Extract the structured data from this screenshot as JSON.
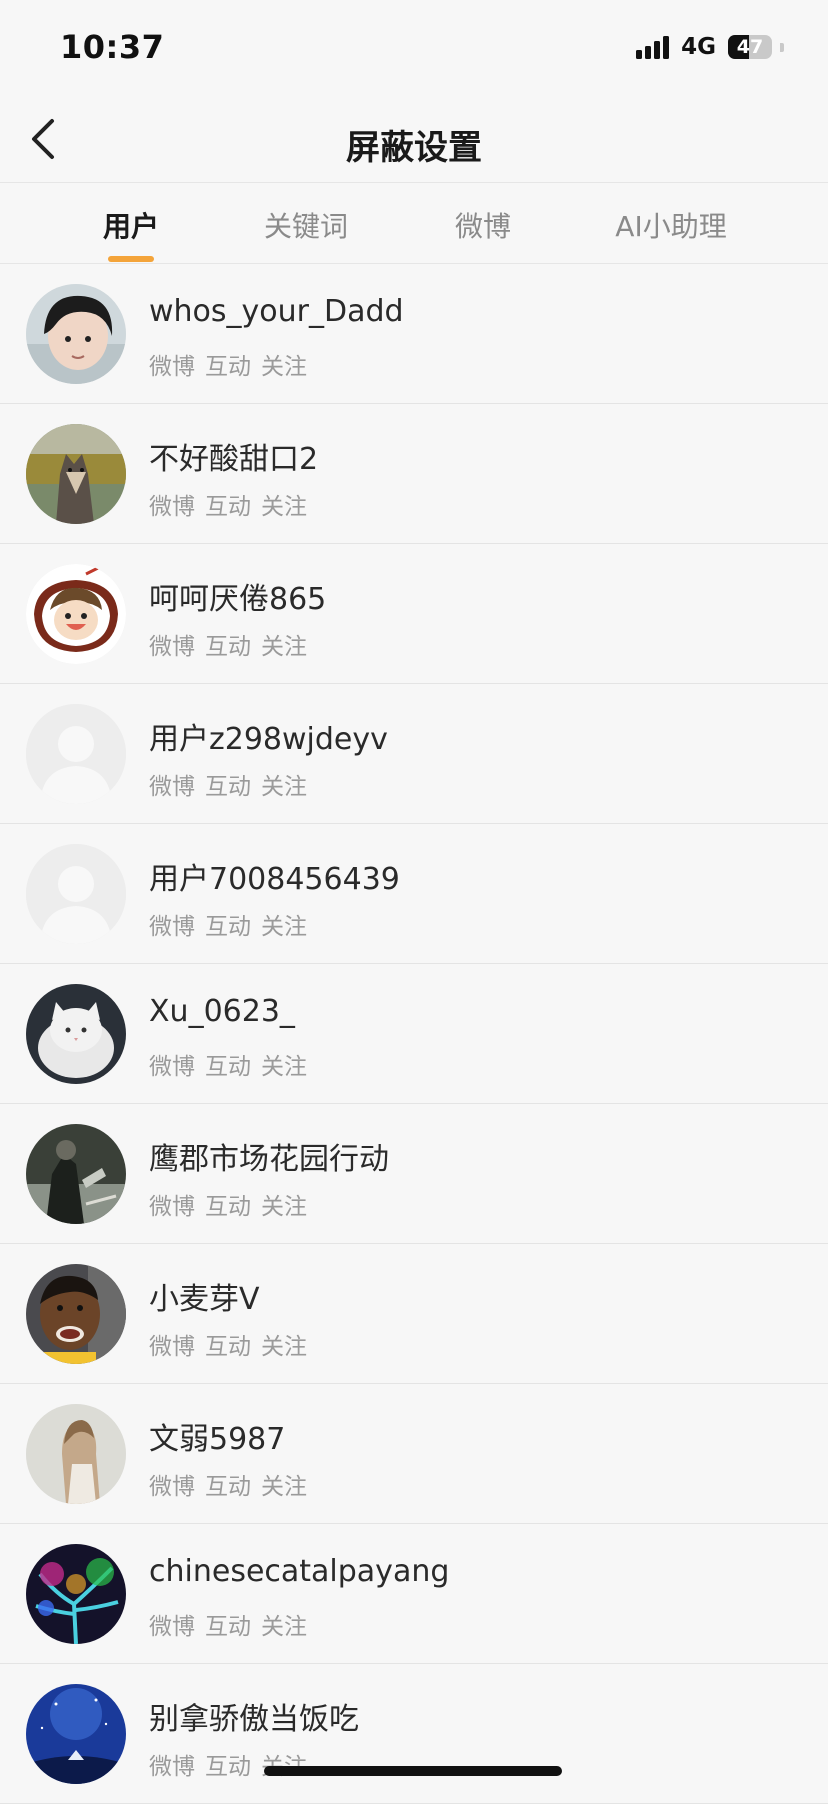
{
  "status": {
    "time": "10:37",
    "network": "4G",
    "battery": "47",
    "battery_level": 0.47
  },
  "nav": {
    "title": "屏蔽设置",
    "back_icon": "chevron-left-icon"
  },
  "tabs": [
    {
      "label": "用户",
      "active": true
    },
    {
      "label": "关键词",
      "active": false
    },
    {
      "label": "微博",
      "active": false
    },
    {
      "label": "AI小助理",
      "active": false
    }
  ],
  "accent_color": "#f4a43a",
  "users": [
    {
      "name": "whos_your_Dadd",
      "avatar": "child-photo"
    },
    {
      "name": "不好酸甜口2",
      "avatar": "dog-photo"
    },
    {
      "name": "呵呵厌倦865",
      "avatar": "cartoon-boy"
    },
    {
      "name": "用户z298wjdeyv",
      "avatar": "default-avatar"
    },
    {
      "name": "用户7008456439",
      "avatar": "default-avatar"
    },
    {
      "name": "Xu_0623_",
      "avatar": "white-cat"
    },
    {
      "name": "鹰郡市场花园行动",
      "avatar": "vintage-photo"
    },
    {
      "name": "小麦芽V",
      "avatar": "basketball-player"
    },
    {
      "name": "文弱5987",
      "avatar": "girl-photo"
    },
    {
      "name": "chinesecatalpayang",
      "avatar": "neon-tree"
    },
    {
      "name": "别拿骄傲当饭吃",
      "avatar": "night-sky"
    }
  ],
  "row_actions": [
    "微博",
    "互动",
    "关注"
  ]
}
